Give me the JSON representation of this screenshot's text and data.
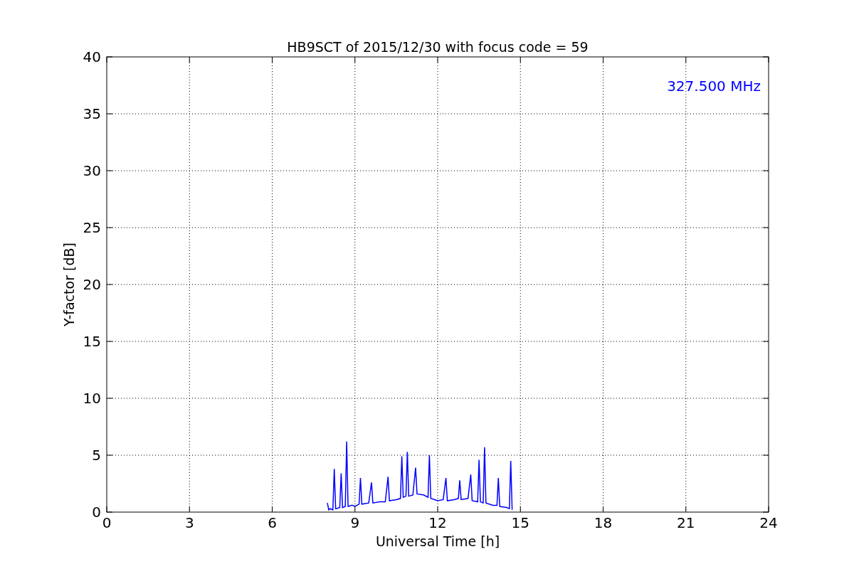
{
  "chart_data": {
    "type": "line",
    "title": "HB9SCT of 2015/12/30 with focus code = 59",
    "xlabel": "Universal Time [h]",
    "ylabel": "Y-factor [dB]",
    "xlim": [
      0,
      24
    ],
    "ylim": [
      0,
      40
    ],
    "xticks": [
      0,
      3,
      6,
      9,
      12,
      15,
      18,
      21,
      24
    ],
    "yticks": [
      0,
      5,
      10,
      15,
      20,
      25,
      30,
      35,
      40
    ],
    "x": [
      8.0,
      8.05,
      8.1,
      8.2,
      8.25,
      8.3,
      8.45,
      8.5,
      8.55,
      8.65,
      8.7,
      8.75,
      8.9,
      9.0,
      9.15,
      9.2,
      9.25,
      9.5,
      9.6,
      9.65,
      9.9,
      10.1,
      10.2,
      10.25,
      10.5,
      10.65,
      10.7,
      10.75,
      10.85,
      10.9,
      10.95,
      11.1,
      11.2,
      11.25,
      11.5,
      11.65,
      11.7,
      11.75,
      12.0,
      12.2,
      12.3,
      12.35,
      12.6,
      12.75,
      12.8,
      12.85,
      13.1,
      13.2,
      13.25,
      13.45,
      13.5,
      13.55,
      13.65,
      13.7,
      13.75,
      14.0,
      14.15,
      14.2,
      14.25,
      14.5,
      14.6,
      14.65,
      14.7
    ],
    "series": [
      {
        "name": "327.500 MHz",
        "color": "#0000ff",
        "values": [
          0.8,
          0.2,
          0.3,
          0.2,
          3.8,
          0.3,
          0.4,
          3.4,
          0.4,
          0.5,
          6.2,
          0.5,
          0.6,
          0.5,
          0.7,
          3.0,
          0.7,
          0.8,
          2.6,
          0.8,
          0.9,
          0.9,
          3.1,
          1.0,
          1.1,
          1.2,
          4.9,
          1.3,
          1.4,
          5.3,
          1.4,
          1.5,
          3.9,
          1.6,
          1.5,
          1.3,
          5.0,
          1.2,
          1.0,
          1.1,
          3.0,
          1.0,
          1.1,
          1.2,
          2.8,
          1.1,
          1.2,
          3.3,
          1.0,
          0.9,
          4.6,
          0.9,
          0.8,
          5.7,
          0.8,
          0.6,
          0.6,
          3.0,
          0.5,
          0.4,
          0.3,
          4.5,
          0.2
        ]
      }
    ],
    "grid": true
  }
}
